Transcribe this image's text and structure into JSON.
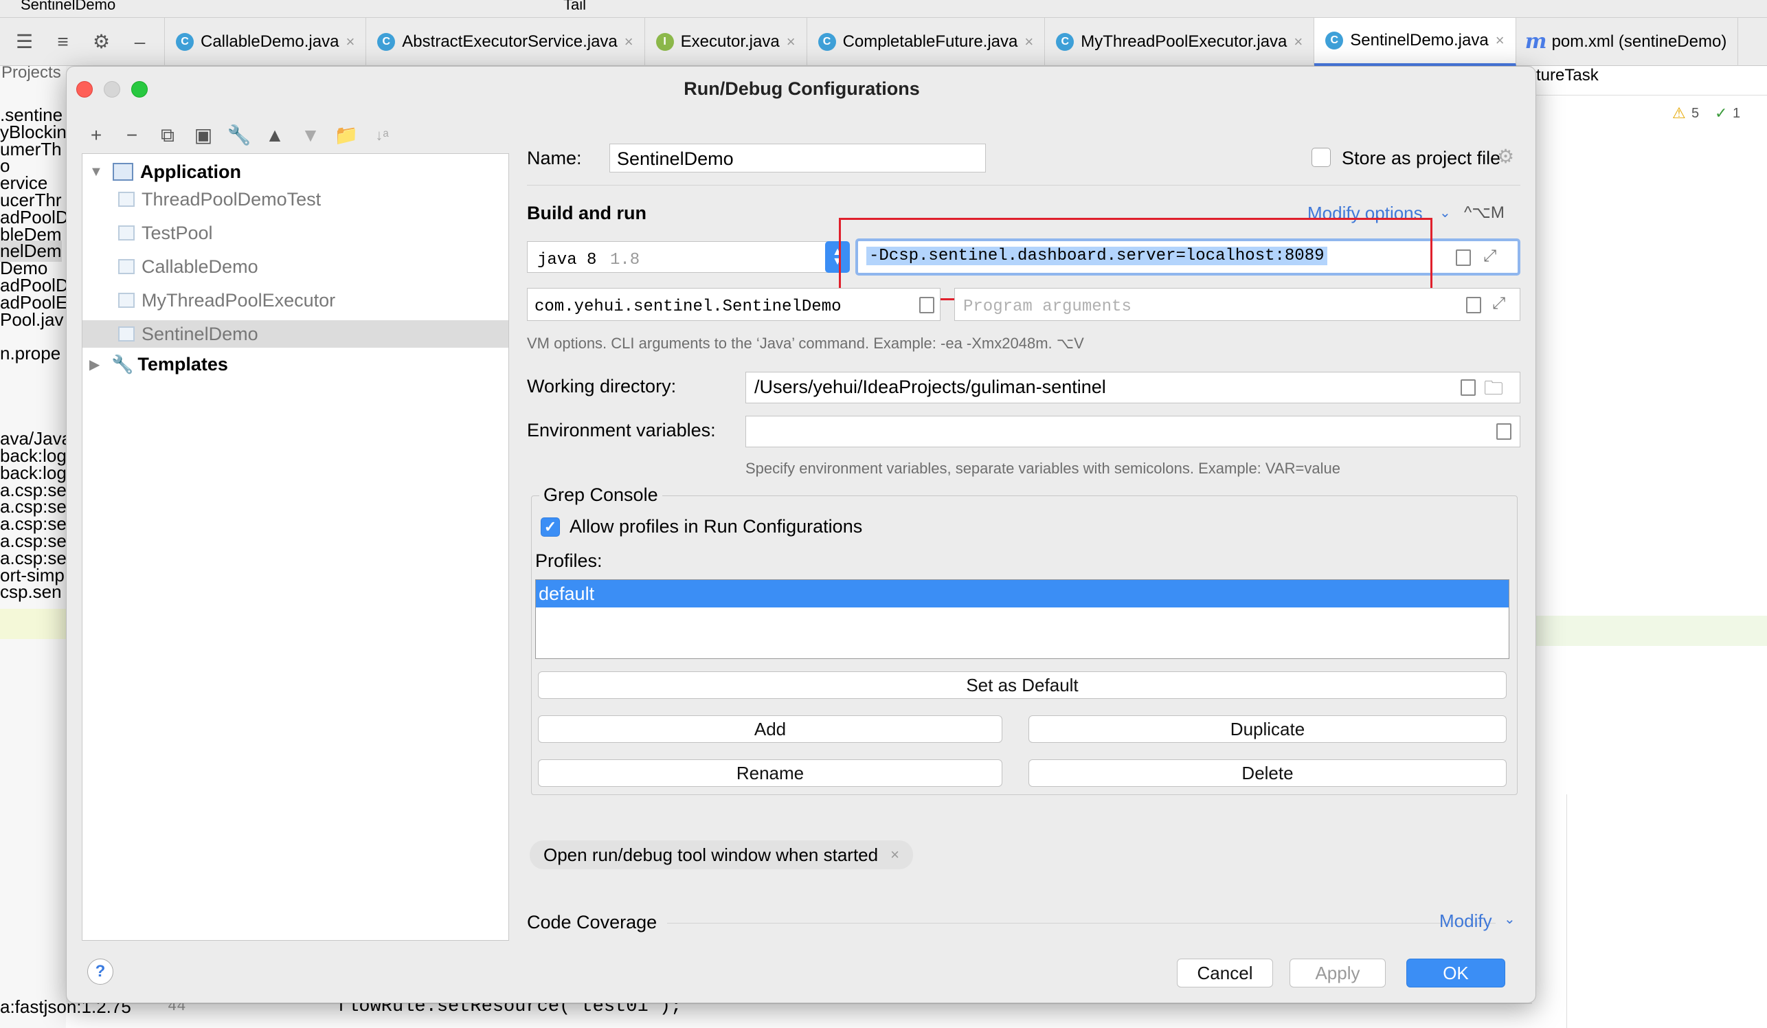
{
  "ide": {
    "run_config_name": "SentinelDemo",
    "toolbar_tail": "Tail",
    "tabs": [
      {
        "label": "CallableDemo.java",
        "icon": "C"
      },
      {
        "label": "AbstractExecutorService.java",
        "icon": "C"
      },
      {
        "label": "Executor.java",
        "icon": "I"
      },
      {
        "label": "CompletableFuture.java",
        "icon": "C"
      },
      {
        "label": "MyThreadPoolExecutor.java",
        "icon": "C"
      },
      {
        "label": "SentinelDemo.java",
        "icon": "C",
        "active": true
      },
      {
        "label": "pom.xml (sentineDemo)",
        "icon": "m"
      }
    ],
    "projects_label": "Projects",
    "left_lines": [
      ".sentine",
      "yBlockin",
      "umerTh",
      "o",
      "ervice",
      "ucerThr",
      "adPoolD",
      "bleDem",
      "nelDem",
      "Demo",
      "adPoolD",
      "adPoolE",
      "Pool.jav",
      "",
      "n.prope",
      "",
      "",
      "",
      "",
      "ava/Java",
      "back:log",
      "back:log",
      "a.csp:se",
      "a.csp:se",
      "a.csp:se",
      "a.csp:se",
      "a.csp:se",
      "ort-simp",
      "csp.sen"
    ],
    "right_tab": "tureTask",
    "warnings": "5",
    "checks": "1",
    "bottom_dep": "a:fastjson:1.2.75",
    "bottom_linenum": "44",
    "bottom_code": "flowRule.setResource(\"test01\");"
  },
  "dialog": {
    "title": "Run/Debug Configurations",
    "tree": {
      "application_label": "Application",
      "items": [
        "ThreadPoolDemoTest",
        "TestPool",
        "CallableDemo",
        "MyThreadPoolExecutor",
        "SentinelDemo"
      ],
      "templates_label": "Templates"
    },
    "name_label": "Name:",
    "name_value": "SentinelDemo",
    "store_label": "Store as project file",
    "build_run_label": "Build and run",
    "modify_options_label": "Modify options",
    "modify_options_shortcut": "^⌥M",
    "jre_value": "java 8",
    "jre_version": "1.8",
    "vm_options_value": "-Dcsp.sentinel.dashboard.server=localhost:8089",
    "main_class_value": "com.yehui.sentinel.SentinelDemo",
    "program_args_placeholder": "Program arguments",
    "vm_hint": "VM options. CLI arguments to the ‘Java’ command. Example: -ea -Xmx2048m. ⌥V",
    "working_dir_label": "Working directory:",
    "working_dir_value": "/Users/yehui/IdeaProjects/guliman-sentinel",
    "env_label": "Environment variables:",
    "env_hint": "Specify environment variables, separate variables with semicolons. Example: VAR=value",
    "grep_console_label": "Grep Console",
    "allow_profiles_label": "Allow profiles in Run Configurations",
    "profiles_label": "Profiles:",
    "profiles": [
      "default"
    ],
    "set_default_label": "Set as Default",
    "add_label": "Add",
    "duplicate_label": "Duplicate",
    "rename_label": "Rename",
    "delete_label": "Delete",
    "open_tool_window_label": "Open run/debug tool window when started",
    "code_coverage_label": "Code Coverage",
    "modify_label": "Modify",
    "cancel_label": "Cancel",
    "apply_label": "Apply",
    "ok_label": "OK",
    "help_label": "?"
  },
  "colors": {
    "accent": "#3b8ef5",
    "highlight_box": "#e0202c",
    "selection_text_bg": "#b3d4fc"
  }
}
